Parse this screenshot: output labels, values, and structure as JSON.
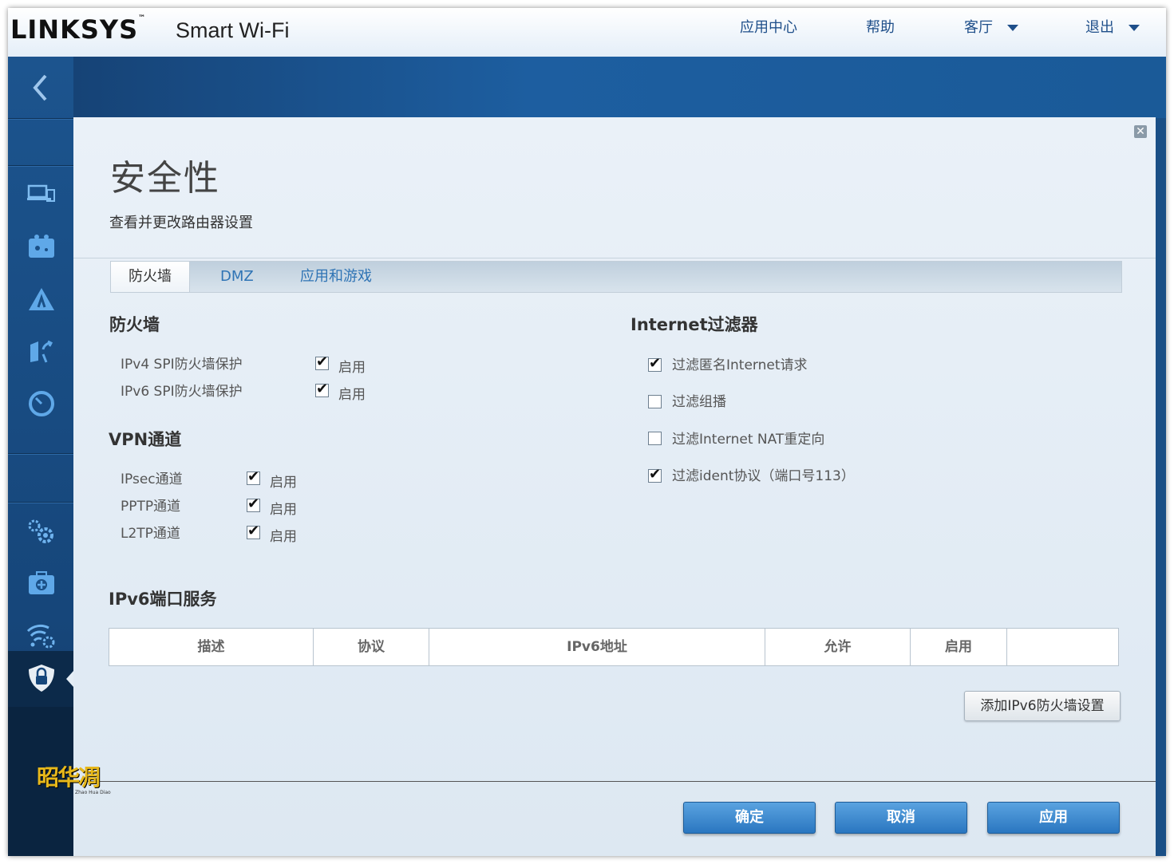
{
  "brand": {
    "logo": "LINKSYS",
    "tm": "™",
    "product": "Smart Wi-Fi"
  },
  "topnav": {
    "app_center": "应用中心",
    "help": "帮助",
    "living_room": "客厅",
    "logout": "退出"
  },
  "page": {
    "title": "安全性",
    "subtitle": "查看并更改路由器设置"
  },
  "tabs": [
    {
      "label": "防火墙",
      "active": true
    },
    {
      "label": "DMZ",
      "active": false
    },
    {
      "label": "应用和游戏",
      "active": false
    }
  ],
  "firewall": {
    "heading": "防火墙",
    "rows": [
      {
        "label": "IPv4 SPI防火墙保护",
        "checked": true,
        "check_label": "启用"
      },
      {
        "label": "IPv6 SPI防火墙保护",
        "checked": true,
        "check_label": "启用"
      }
    ]
  },
  "vpn": {
    "heading": "VPN通道",
    "rows": [
      {
        "label": "IPsec通道",
        "checked": true,
        "check_label": "启用"
      },
      {
        "label": "PPTP通道",
        "checked": true,
        "check_label": "启用"
      },
      {
        "label": "L2TP通道",
        "checked": true,
        "check_label": "启用"
      }
    ]
  },
  "filters": {
    "heading": "Internet过滤器",
    "rows": [
      {
        "label": "过滤匿名Internet请求",
        "checked": true
      },
      {
        "label": "过滤组播",
        "checked": false
      },
      {
        "label": "过滤Internet NAT重定向",
        "checked": false
      },
      {
        "label": "过滤ident协议（端口号113）",
        "checked": true
      }
    ]
  },
  "ipv6": {
    "heading": "IPv6端口服务",
    "columns": [
      "描述",
      "协议",
      "IPv6地址",
      "允许",
      "启用",
      ""
    ],
    "add_button": "添加IPv6防火墙设置"
  },
  "buttons": {
    "ok": "确定",
    "cancel": "取消",
    "apply": "应用"
  },
  "watermark": {
    "text": "昭华凋",
    "sub": "Zhao Hua Diao"
  },
  "colors": {
    "accent": "#2f74b5",
    "sidebar": "#1a4f86",
    "button": "#3b8ad2"
  },
  "icons": [
    "back-arrow-icon",
    "devices-icon",
    "parental-icon",
    "warning-icon",
    "media-icon",
    "speed-icon",
    "settings-icon",
    "troubleshoot-icon",
    "wifi-settings-icon",
    "security-icon"
  ]
}
